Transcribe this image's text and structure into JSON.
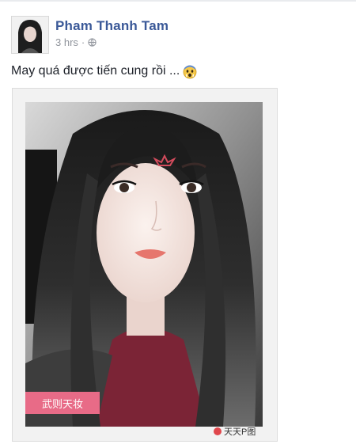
{
  "post": {
    "author_name": "Pham Thanh Tam",
    "time": "3 hrs",
    "privacy_icon": "globe-icon",
    "status_text": "May quá được tiến cung rồi ...",
    "status_emoji": "fearful-face-emoji"
  },
  "photo": {
    "tag_badge_text": "武则天妆",
    "watermark_text": "天天P图",
    "badge_color": "#e86b87",
    "watermark_dot_color": "#e0474c"
  },
  "colors": {
    "author": "#3b5998",
    "meta": "#90949c",
    "text": "#1d2129"
  }
}
